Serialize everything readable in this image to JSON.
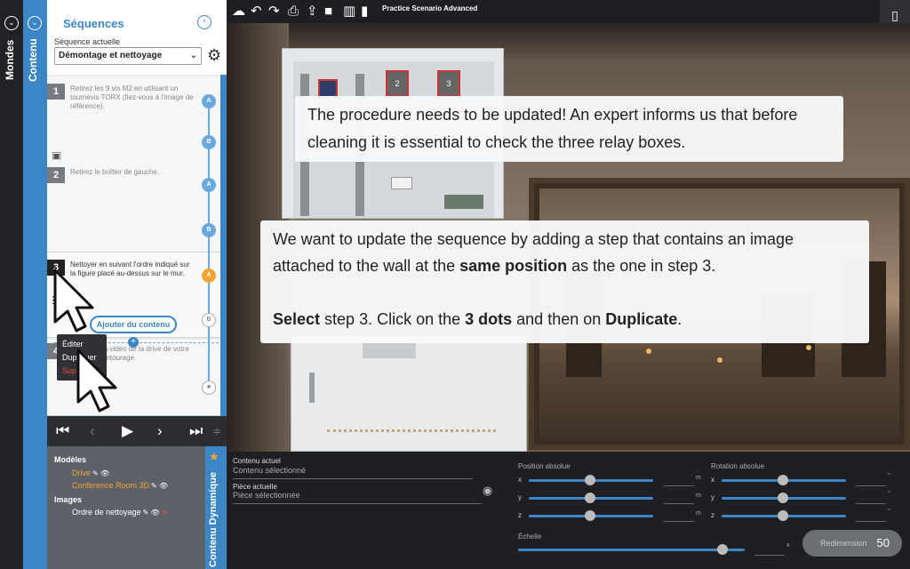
{
  "rails": {
    "mondes_label": "Mondes",
    "contenu_label": "Contenu"
  },
  "panel": {
    "title": "Séquences",
    "sequence_label": "Séquence actuelle",
    "sequence_value": "Démontage et nettoyage",
    "steps": [
      {
        "num": "1",
        "text": "Retirez les 9 vis M2 en utilisant un tournevis TORX (fiez-vous à l'image de référence)."
      },
      {
        "num": "2",
        "text": "Retirez le boîtier de gauche."
      },
      {
        "num": "3",
        "text": "Nettoyer en suivant l'ordre indiqué sur la figure placé au-dessus sur le mur."
      },
      {
        "num": "4",
        "text": "la vidéo de la drive de votre entourage."
      }
    ],
    "timeline_dots": [
      "A",
      "B",
      "A",
      "B",
      "A",
      "B"
    ],
    "add_content_label": "Ajouter du contenu",
    "context_menu": [
      "Éditer",
      "Dupliquer",
      "Supprimer"
    ]
  },
  "bottom_left": {
    "models_heading": "Modèles",
    "models": [
      "Drive",
      "Conference Room 3D"
    ],
    "images_heading": "Images",
    "images": [
      "Ordre de nettoyage"
    ],
    "vertical_tab_label": "Contenu Dynamique"
  },
  "toolbar": {
    "title": "Practice Scenario Advanced"
  },
  "tooltips": {
    "top": "The procedure needs to be updated! An expert informs us that before cleaning it is essential to check the three relay boxes.",
    "main_line1": "We want to update the sequence by adding a step that contains an image attached to the wall at the ",
    "main_bold1": "same position",
    "main_line1_end": " as the one in step 3.",
    "main_select": "Select",
    "main_mid": " step 3. Click on the ",
    "main_bold2": "3 dots",
    "main_mid2": " and then on ",
    "main_bold3": "Duplicate",
    "main_end": "."
  },
  "props": {
    "current_content_label": "Contenu actuel",
    "current_content_value": "Contenu sélectionné",
    "current_piece_label": "Pièce actuelle",
    "current_piece_value": "Pièce sélectionnée",
    "position_label": "Position absolue",
    "rotation_label": "Rotation absolue",
    "scale_label": "Échelle",
    "axes": [
      "x",
      "y",
      "z"
    ],
    "position_unit": "m",
    "rotation_unit": "°",
    "scale_unit": "x",
    "resize_label": "Redimension",
    "resize_value": "50"
  },
  "relays": [
    "2",
    "3"
  ]
}
